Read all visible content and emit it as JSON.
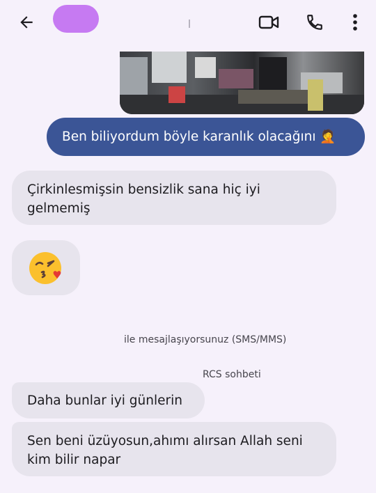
{
  "header": {
    "back_icon": "arrow-left-icon",
    "video_icon": "video-camera-icon",
    "call_icon": "phone-icon",
    "more_icon": "more-vertical-icon",
    "avatar_color": "#c67af2",
    "accent": "#3b5596"
  },
  "messages": {
    "sent_1": "Ben biliyordum böyle karanlık olacağını 🤦",
    "recv_1": "Çirkinlesmişsin bensizlik sana hiç iyi gelmemiş",
    "recv_2_emoji": "face-blowing-kiss-icon",
    "info_1": "ile mesajlaşıyorsunuz (SMS/MMS)",
    "info_2": "RCS sohbeti",
    "recv_3": "Daha bunlar iyi günlerin",
    "recv_4": "Sen beni üzüyosun,ahımı alırsan Allah seni kim bilir napar"
  }
}
